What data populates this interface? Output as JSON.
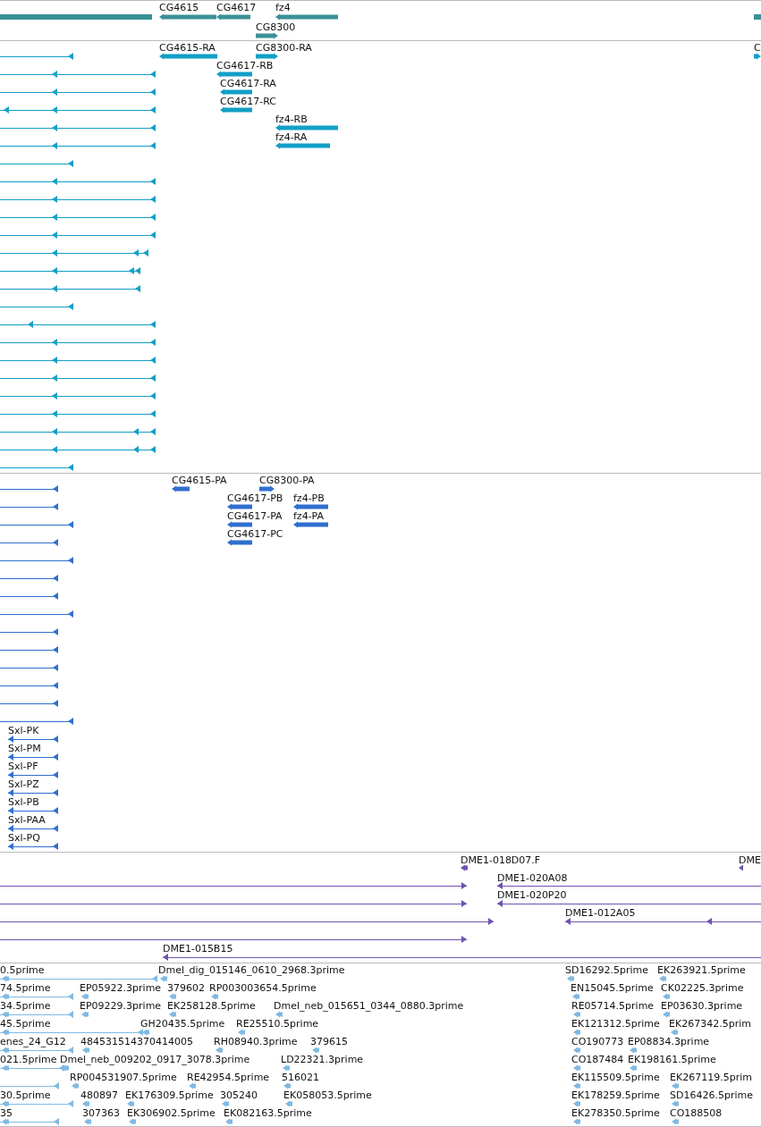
{
  "tracks": [
    {
      "kind": "gene",
      "features": [
        {
          "label": "CG4615"
        },
        {
          "label": "CG4617"
        },
        {
          "label": "fz4"
        },
        {
          "label": "CG8300"
        }
      ]
    },
    {
      "kind": "transcript",
      "features": [
        {
          "label": "CG4615-RA"
        },
        {
          "label": "CG8300-RA"
        },
        {
          "label": "CG4617-RB"
        },
        {
          "label": "CG4617-RA"
        },
        {
          "label": "CG4617-RC"
        },
        {
          "label": "fz4-RB"
        },
        {
          "label": "fz4-RA"
        },
        {
          "label": "C"
        }
      ]
    },
    {
      "kind": "protein",
      "features": [
        {
          "label": "CG4615-PA"
        },
        {
          "label": "CG8300-PA"
        },
        {
          "label": "CG4617-PB"
        },
        {
          "label": "fz4-PB"
        },
        {
          "label": "CG4617-PA"
        },
        {
          "label": "fz4-PA"
        },
        {
          "label": "CG4617-PC"
        },
        {
          "label": "Sxl-PK"
        },
        {
          "label": "Sxl-PM"
        },
        {
          "label": "Sxl-PF"
        },
        {
          "label": "Sxl-PZ"
        },
        {
          "label": "Sxl-PB"
        },
        {
          "label": "Sxl-PAA"
        },
        {
          "label": "Sxl-PQ"
        }
      ]
    },
    {
      "kind": "clone",
      "features": [
        {
          "label": "DME1-018D07.F"
        },
        {
          "label": "DME"
        },
        {
          "label": "DME1-020A08"
        },
        {
          "label": "DME1-020P20"
        },
        {
          "label": "DME1-012A05"
        },
        {
          "label": "DME1-015B15"
        }
      ]
    },
    {
      "kind": "est",
      "features": [
        {
          "label": "0.5prime"
        },
        {
          "label": "Dmel_dig_015146_0610_2968.3prime"
        },
        {
          "label": "SD16292.5prime"
        },
        {
          "label": "EK263921.5prime"
        },
        {
          "label": "74.5prime"
        },
        {
          "label": "EP05922.3prime"
        },
        {
          "label": "379602"
        },
        {
          "label": "RP003003654.5prime"
        },
        {
          "label": "EN15045.5prime"
        },
        {
          "label": "CK02225.3prime"
        },
        {
          "label": "34.5prime"
        },
        {
          "label": "EP09229.3prime"
        },
        {
          "label": "EK258128.5prime"
        },
        {
          "label": "Dmel_neb_015651_0344_0880.3prime"
        },
        {
          "label": "RE05714.5prime"
        },
        {
          "label": "EP03630.3prime"
        },
        {
          "label": "45.5prime"
        },
        {
          "label": "GH20435.5prime"
        },
        {
          "label": "RE25510.5prime"
        },
        {
          "label": "EK121312.5prime"
        },
        {
          "label": "EK267342.5prim"
        },
        {
          "label": "enes_24_G12"
        },
        {
          "label": "484531514370414005"
        },
        {
          "label": "RH08940.3prime"
        },
        {
          "label": "379615"
        },
        {
          "label": "CO190773"
        },
        {
          "label": "EP08834.3prime"
        },
        {
          "label": "021.5prime"
        },
        {
          "label": "Dmel_neb_009202_0917_3078.3prime"
        },
        {
          "label": "LD22321.3prime"
        },
        {
          "label": "CO187484"
        },
        {
          "label": "EK198161.5prime"
        },
        {
          "label": "RP004531907.5prime"
        },
        {
          "label": "RE42954.5prime"
        },
        {
          "label": "516021"
        },
        {
          "label": "EK115509.5prime"
        },
        {
          "label": "EK267119.5prim"
        },
        {
          "label": "30.5prime"
        },
        {
          "label": "480897"
        },
        {
          "label": "EK176309.5prime"
        },
        {
          "label": "305240"
        },
        {
          "label": "EK058053.5prime"
        },
        {
          "label": "EK178259.5prime"
        },
        {
          "label": "SD16426.5prime"
        },
        {
          "label": "35"
        },
        {
          "label": "307363"
        },
        {
          "label": "EK306902.5prime"
        },
        {
          "label": "EK082163.5prime"
        },
        {
          "label": "EK278350.5prime"
        },
        {
          "label": "CO188508"
        }
      ]
    }
  ]
}
